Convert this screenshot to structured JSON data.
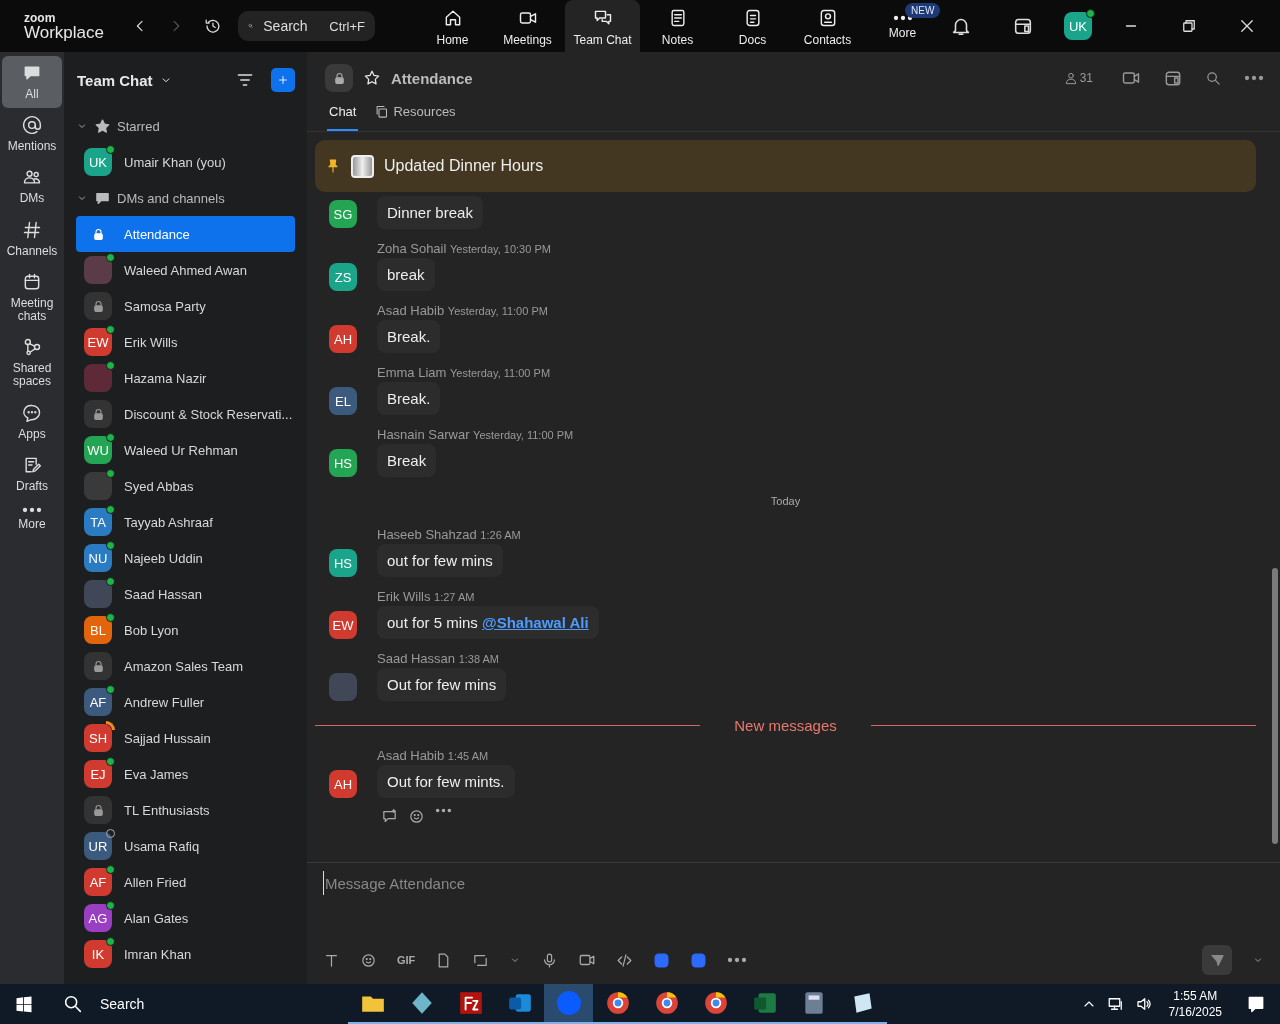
{
  "app": {
    "logo_top": "zoom",
    "logo_bottom": "Workplace",
    "search": {
      "placeholder": "Search",
      "shortcut": "Ctrl+F"
    },
    "nav": [
      {
        "label": "Home",
        "kind": "home",
        "selected": false
      },
      {
        "label": "Meetings",
        "kind": "meetings",
        "selected": false
      },
      {
        "label": "Team Chat",
        "kind": "chat",
        "selected": true
      },
      {
        "label": "Notes",
        "kind": "notes",
        "selected": false
      },
      {
        "label": "Docs",
        "kind": "docs",
        "selected": false
      },
      {
        "label": "Contacts",
        "kind": "contacts",
        "selected": false
      },
      {
        "label": "More",
        "kind": "more",
        "selected": false,
        "badge": "NEW"
      }
    ],
    "user": {
      "initials": "UK",
      "color": "#1aa58a",
      "online": true
    }
  },
  "rail": [
    {
      "label": "All",
      "kind": "all",
      "selected": true
    },
    {
      "label": "Mentions",
      "kind": "mentions",
      "selected": false
    },
    {
      "label": "DMs",
      "kind": "dms",
      "selected": false
    },
    {
      "label": "Channels",
      "kind": "channels",
      "selected": false
    },
    {
      "label": "Meeting chats",
      "kind": "meeting",
      "selected": false
    },
    {
      "label": "Shared spaces",
      "kind": "shared",
      "selected": false
    },
    {
      "label": "Apps",
      "kind": "apps",
      "selected": false
    },
    {
      "label": "Drafts",
      "kind": "drafts",
      "selected": false
    },
    {
      "label": "More",
      "kind": "more",
      "selected": false
    }
  ],
  "sidebar": {
    "title": "Team Chat",
    "sections": [
      {
        "title": "Starred",
        "kind": "starred",
        "expanded": true,
        "items": [
          {
            "name": "Umair Khan (you)",
            "kind": "initials",
            "initials": "UK",
            "color": "#1aa58a",
            "online": true,
            "selected": false
          }
        ]
      },
      {
        "title": "DMs and channels",
        "kind": "dms",
        "expanded": true,
        "items": [
          {
            "name": "Attendance",
            "kind": "channel",
            "selected": true
          },
          {
            "name": "Waleed Ahmed Awan",
            "kind": "photo",
            "color": "#5b3b48",
            "online": true,
            "selected": false
          },
          {
            "name": "Samosa Party",
            "kind": "channel",
            "selected": false
          },
          {
            "name": "Erik Wills",
            "kind": "initials",
            "initials": "EW",
            "color": "#d03a2f",
            "online": true,
            "selected": false
          },
          {
            "name": "Hazama Nazir",
            "kind": "photo",
            "color": "#5e2a38",
            "online": true,
            "selected": false
          },
          {
            "name": "Discount & Stock Reservati...",
            "kind": "channel",
            "selected": false
          },
          {
            "name": "Waleed Ur Rehman",
            "kind": "initials",
            "initials": "WU",
            "color": "#23a553",
            "online": true,
            "selected": false
          },
          {
            "name": "Syed Abbas",
            "kind": "photo",
            "color": "#3a3a3a",
            "online": true,
            "selected": false
          },
          {
            "name": "Tayyab Ashraaf",
            "kind": "initials",
            "initials": "TA",
            "color": "#2a7bc2",
            "online": true,
            "selected": false
          },
          {
            "name": "Najeeb Uddin",
            "kind": "initials",
            "initials": "NU",
            "color": "#2a7bc2",
            "online": true,
            "selected": false
          },
          {
            "name": "Saad Hassan",
            "kind": "photo",
            "color": "#404858",
            "online": true,
            "selected": false
          },
          {
            "name": "Bob Lyon",
            "kind": "initials",
            "initials": "BL",
            "color": "#e2650c",
            "online": true,
            "selected": false
          },
          {
            "name": "Amazon Sales Team",
            "kind": "channel",
            "selected": false
          },
          {
            "name": "Andrew Fuller",
            "kind": "initials",
            "initials": "AF",
            "color": "#3b5a7d",
            "online": true,
            "selected": false
          },
          {
            "name": "Sajjad Hussain",
            "kind": "initials",
            "initials": "SH",
            "color": "#d03a2f",
            "online": false,
            "in_call": true,
            "selected": false
          },
          {
            "name": "Eva James",
            "kind": "initials",
            "initials": "EJ",
            "color": "#d03a2f",
            "online": true,
            "selected": false
          },
          {
            "name": "TL Enthusiasts",
            "kind": "channel",
            "selected": false
          },
          {
            "name": "Usama Rafiq",
            "kind": "initials",
            "initials": "UR",
            "color": "#3b5a7d",
            "online": false,
            "in_call": false,
            "selected": false
          },
          {
            "name": "Allen Fried",
            "kind": "initials",
            "initials": "AF",
            "color": "#d03a2f",
            "online": true,
            "selected": false
          },
          {
            "name": "Alan Gates",
            "kind": "initials",
            "initials": "AG",
            "color": "#9a3fc2",
            "online": true,
            "selected": false
          },
          {
            "name": "Imran Khan",
            "kind": "initials",
            "initials": "IK",
            "color": "#d03a2f",
            "online": true,
            "selected": false
          }
        ]
      }
    ]
  },
  "chat": {
    "title": "Attendance",
    "members": "31",
    "tabs": [
      {
        "label": "Chat",
        "selected": true
      },
      {
        "label": "Resources",
        "selected": false
      }
    ],
    "pinned": "Updated Dinner Hours",
    "feed": [
      {
        "kind": "message",
        "initials": "SG",
        "color": "#23a553",
        "text": "Dinner break"
      },
      {
        "kind": "message",
        "sender": "Zoha Sohail",
        "time": "Yesterday, 10:30 PM",
        "initials": "ZS",
        "color": "#1aa58a",
        "text": "break"
      },
      {
        "kind": "message",
        "sender": "Asad Habib",
        "time": "Yesterday, 11:00 PM",
        "initials": "AH",
        "color": "#d03a2f",
        "text": "Break."
      },
      {
        "kind": "message",
        "sender": "Emma Liam",
        "time": "Yesterday, 11:00 PM",
        "initials": "EL",
        "color": "#3b5a7d",
        "text": "Break."
      },
      {
        "kind": "message",
        "sender": "Hasnain Sarwar",
        "time": "Yesterday, 11:00 PM",
        "initials": "HS",
        "color": "#23a553",
        "text": "Break"
      },
      {
        "kind": "date",
        "text": "Today"
      },
      {
        "kind": "message",
        "sender": "Haseeb Shahzad",
        "time": "1:26 AM",
        "initials": "HS",
        "color": "#1aa58a",
        "text": "out for few mins"
      },
      {
        "kind": "message",
        "sender": "Erik Wills",
        "time": "1:27 AM",
        "initials": "EW",
        "color": "#d03a2f",
        "text": "out for 5 mins ",
        "mention": "@Shahawal Ali"
      },
      {
        "kind": "message",
        "sender": "Saad Hassan",
        "time": "1:38 AM",
        "color": "#404858",
        "text": "Out for few mins"
      },
      {
        "kind": "new",
        "text": "New messages"
      },
      {
        "kind": "message",
        "sender": "Asad Habib",
        "time": "1:45 AM",
        "initials": "AH",
        "color": "#d03a2f",
        "text": "Out for few mints.",
        "show_actions": true
      }
    ],
    "composer": {
      "placeholder": "Message Attendance",
      "gif": "GIF"
    }
  },
  "taskbar": {
    "search": "Search",
    "time": "1:55 AM",
    "date": "7/16/2025",
    "apps": [
      {
        "kind": "folder",
        "active": false
      },
      {
        "kind": "diamond",
        "active": false
      },
      {
        "kind": "fz",
        "active": false
      },
      {
        "kind": "mail",
        "active": false
      },
      {
        "kind": "zoom",
        "active": true
      },
      {
        "kind": "browser",
        "active": false
      },
      {
        "kind": "browser",
        "active": false
      },
      {
        "kind": "browser",
        "active": false
      },
      {
        "kind": "sheet",
        "active": false
      },
      {
        "kind": "calc",
        "active": false
      },
      {
        "kind": "note",
        "active": false
      }
    ]
  }
}
